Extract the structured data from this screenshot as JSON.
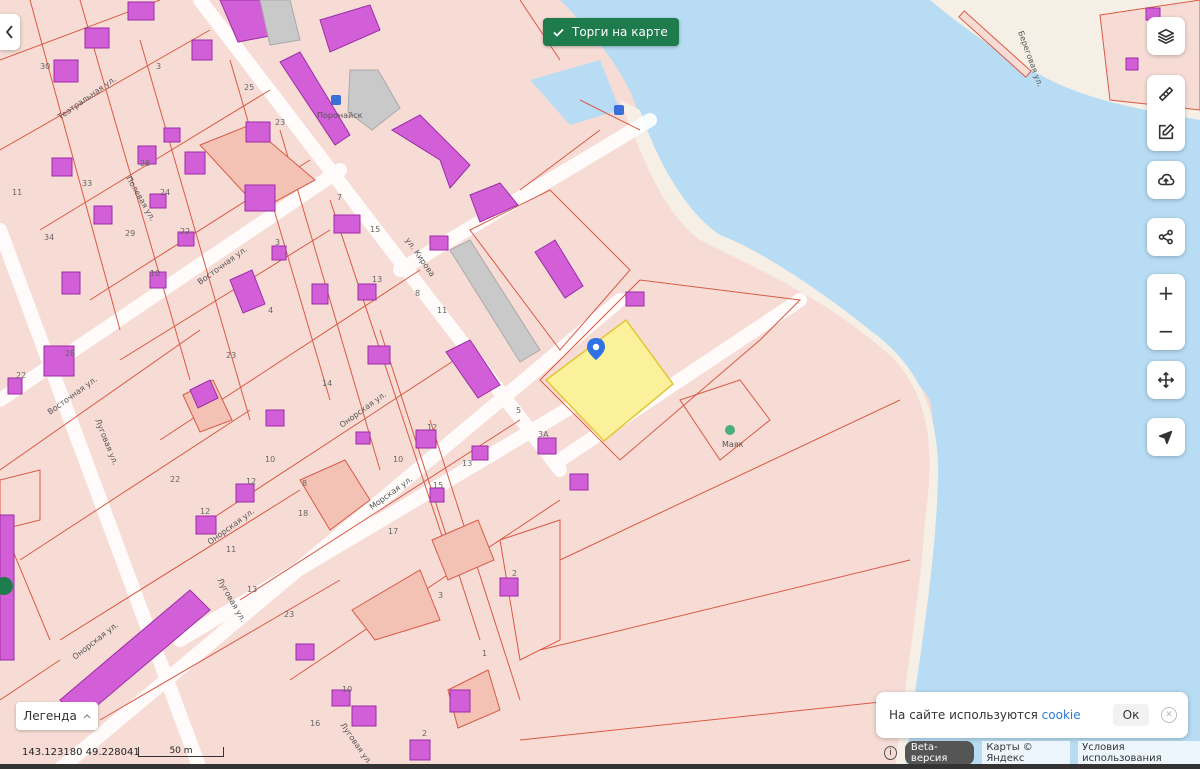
{
  "colors": {
    "water": "#b7dcf3",
    "parcel_fill": "#f7d9d4",
    "parcel_border": "#d95a45",
    "building": "#d35fd8",
    "selected_parcel": "#fbf19a",
    "torgi_button": "#1e7c4c",
    "marker": "#2f72e6"
  },
  "top": {
    "back_icon": "chevron-left-icon",
    "torgi_label": "Торги на карте"
  },
  "controls": {
    "layers_icon": "layers-icon",
    "ruler_icon": "ruler-icon",
    "edit_icon": "edit-icon",
    "upload_icon": "cloud-upload-icon",
    "share_icon": "share-icon",
    "zoom_in": "+",
    "zoom_out": "−",
    "move_icon": "move-icon",
    "locate_icon": "locate-arrow-icon"
  },
  "map": {
    "streets": [
      "Театральная ул.",
      "Полевая ул.",
      "Восточная ул.",
      "Восточная ул.",
      "Луговая ул.",
      "Онорская ул.",
      "Онорская ул.",
      "Морская ул.",
      "Луговая ул.",
      "Онорская ул.",
      "Луговая ул.",
      "ул. Кирова",
      "Береговая ул."
    ],
    "poi": [
      "Поронайск",
      "Маяк"
    ],
    "house_numbers": [
      "30",
      "3",
      "25",
      "23",
      "33",
      "11",
      "34",
      "24",
      "29",
      "28",
      "22",
      "10",
      "7",
      "4",
      "3",
      "11",
      "28",
      "15",
      "8",
      "13",
      "14",
      "23",
      "22",
      "10",
      "12",
      "10",
      "12",
      "5",
      "3А",
      "13",
      "15",
      "22",
      "18",
      "8",
      "11",
      "12",
      "17",
      "2",
      "3",
      "13",
      "23",
      "1",
      "16",
      "10",
      "2"
    ]
  },
  "legend": {
    "label": "Легенда"
  },
  "status": {
    "coordinates": "143.123180  49.228041",
    "scale": "50 m"
  },
  "cookie": {
    "text": "На сайте используются ",
    "link": "cookie",
    "ok": "Ок"
  },
  "footer": {
    "beta": "Beta-версия",
    "maps": "Карты © Яндекс",
    "terms": "Условия использования"
  }
}
